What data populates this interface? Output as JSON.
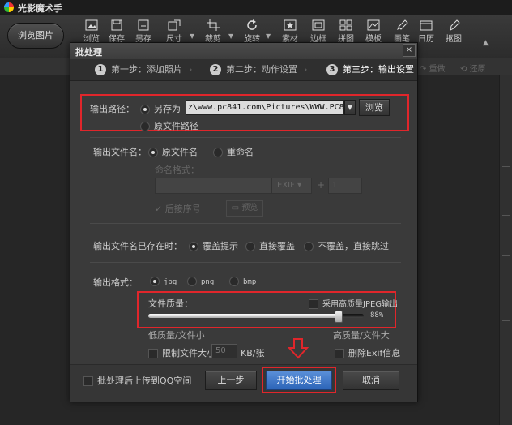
{
  "app": {
    "title": "光影魔术手"
  },
  "toolbar": {
    "browse_label": "浏览图片",
    "items": [
      {
        "label": "浏览",
        "icon": "image-icon"
      },
      {
        "label": "保存",
        "icon": "save-icon"
      },
      {
        "label": "另存",
        "icon": "save-as-icon"
      },
      {
        "label": "尺寸",
        "icon": "resize-icon"
      },
      {
        "label": "裁剪",
        "icon": "crop-icon"
      },
      {
        "label": "旋转",
        "icon": "rotate-icon"
      },
      {
        "label": "素材",
        "icon": "star-icon"
      },
      {
        "label": "边框",
        "icon": "frame-icon"
      },
      {
        "label": "拼图",
        "icon": "grid-icon"
      },
      {
        "label": "模板",
        "icon": "template-icon"
      },
      {
        "label": "画笔",
        "icon": "brush-icon"
      },
      {
        "label": "日历",
        "icon": "calendar-icon"
      },
      {
        "label": "抠图",
        "icon": "pen-icon"
      }
    ],
    "undo_label": "重做",
    "restore_label": "还原"
  },
  "dialog": {
    "title": "批处理",
    "close": "×",
    "steps": [
      {
        "num": "1",
        "label": "第一步：添加照片"
      },
      {
        "num": "2",
        "label": "第二步：动作设置"
      },
      {
        "num": "3",
        "label": "第三步：输出设置"
      }
    ],
    "output_path": {
      "label": "输出路径：",
      "save_as": "另存为",
      "path_value": "z\\www.pc841.com\\Pictures\\WWW.PC841.COM",
      "browse": "浏览",
      "original": "原文件路径"
    },
    "filename": {
      "label": "输出文件名：",
      "original": "原文件名",
      "rename": "重命名",
      "pattern_label": "命名格式：",
      "ext": "EXIF",
      "plus": "+",
      "counter": "1",
      "seq_label": "后接序号",
      "preview": "预览"
    },
    "exists": {
      "label": "输出文件名已存在时：",
      "opt1": "覆盖提示",
      "opt2": "直接覆盖",
      "opt3": "不覆盖，直接跳过"
    },
    "format": {
      "label": "输出格式：",
      "jpg": "jpg",
      "png": "png",
      "bmp": "bmp"
    },
    "quality": {
      "label": "文件质量：",
      "hq_label": "采用高质量JPEG输出",
      "percent": 88,
      "percent_text": "88%",
      "low": "低质量/文件小",
      "high": "高质量/文件大",
      "limit_label": "限制文件大小",
      "limit_value": "50",
      "limit_unit": "KB/张",
      "exif_label": "删除Exif信息"
    },
    "footer": {
      "upload_label": "批处理后上传到QQ空间",
      "prev": "上一步",
      "start": "开始批处理",
      "cancel": "取消"
    }
  }
}
